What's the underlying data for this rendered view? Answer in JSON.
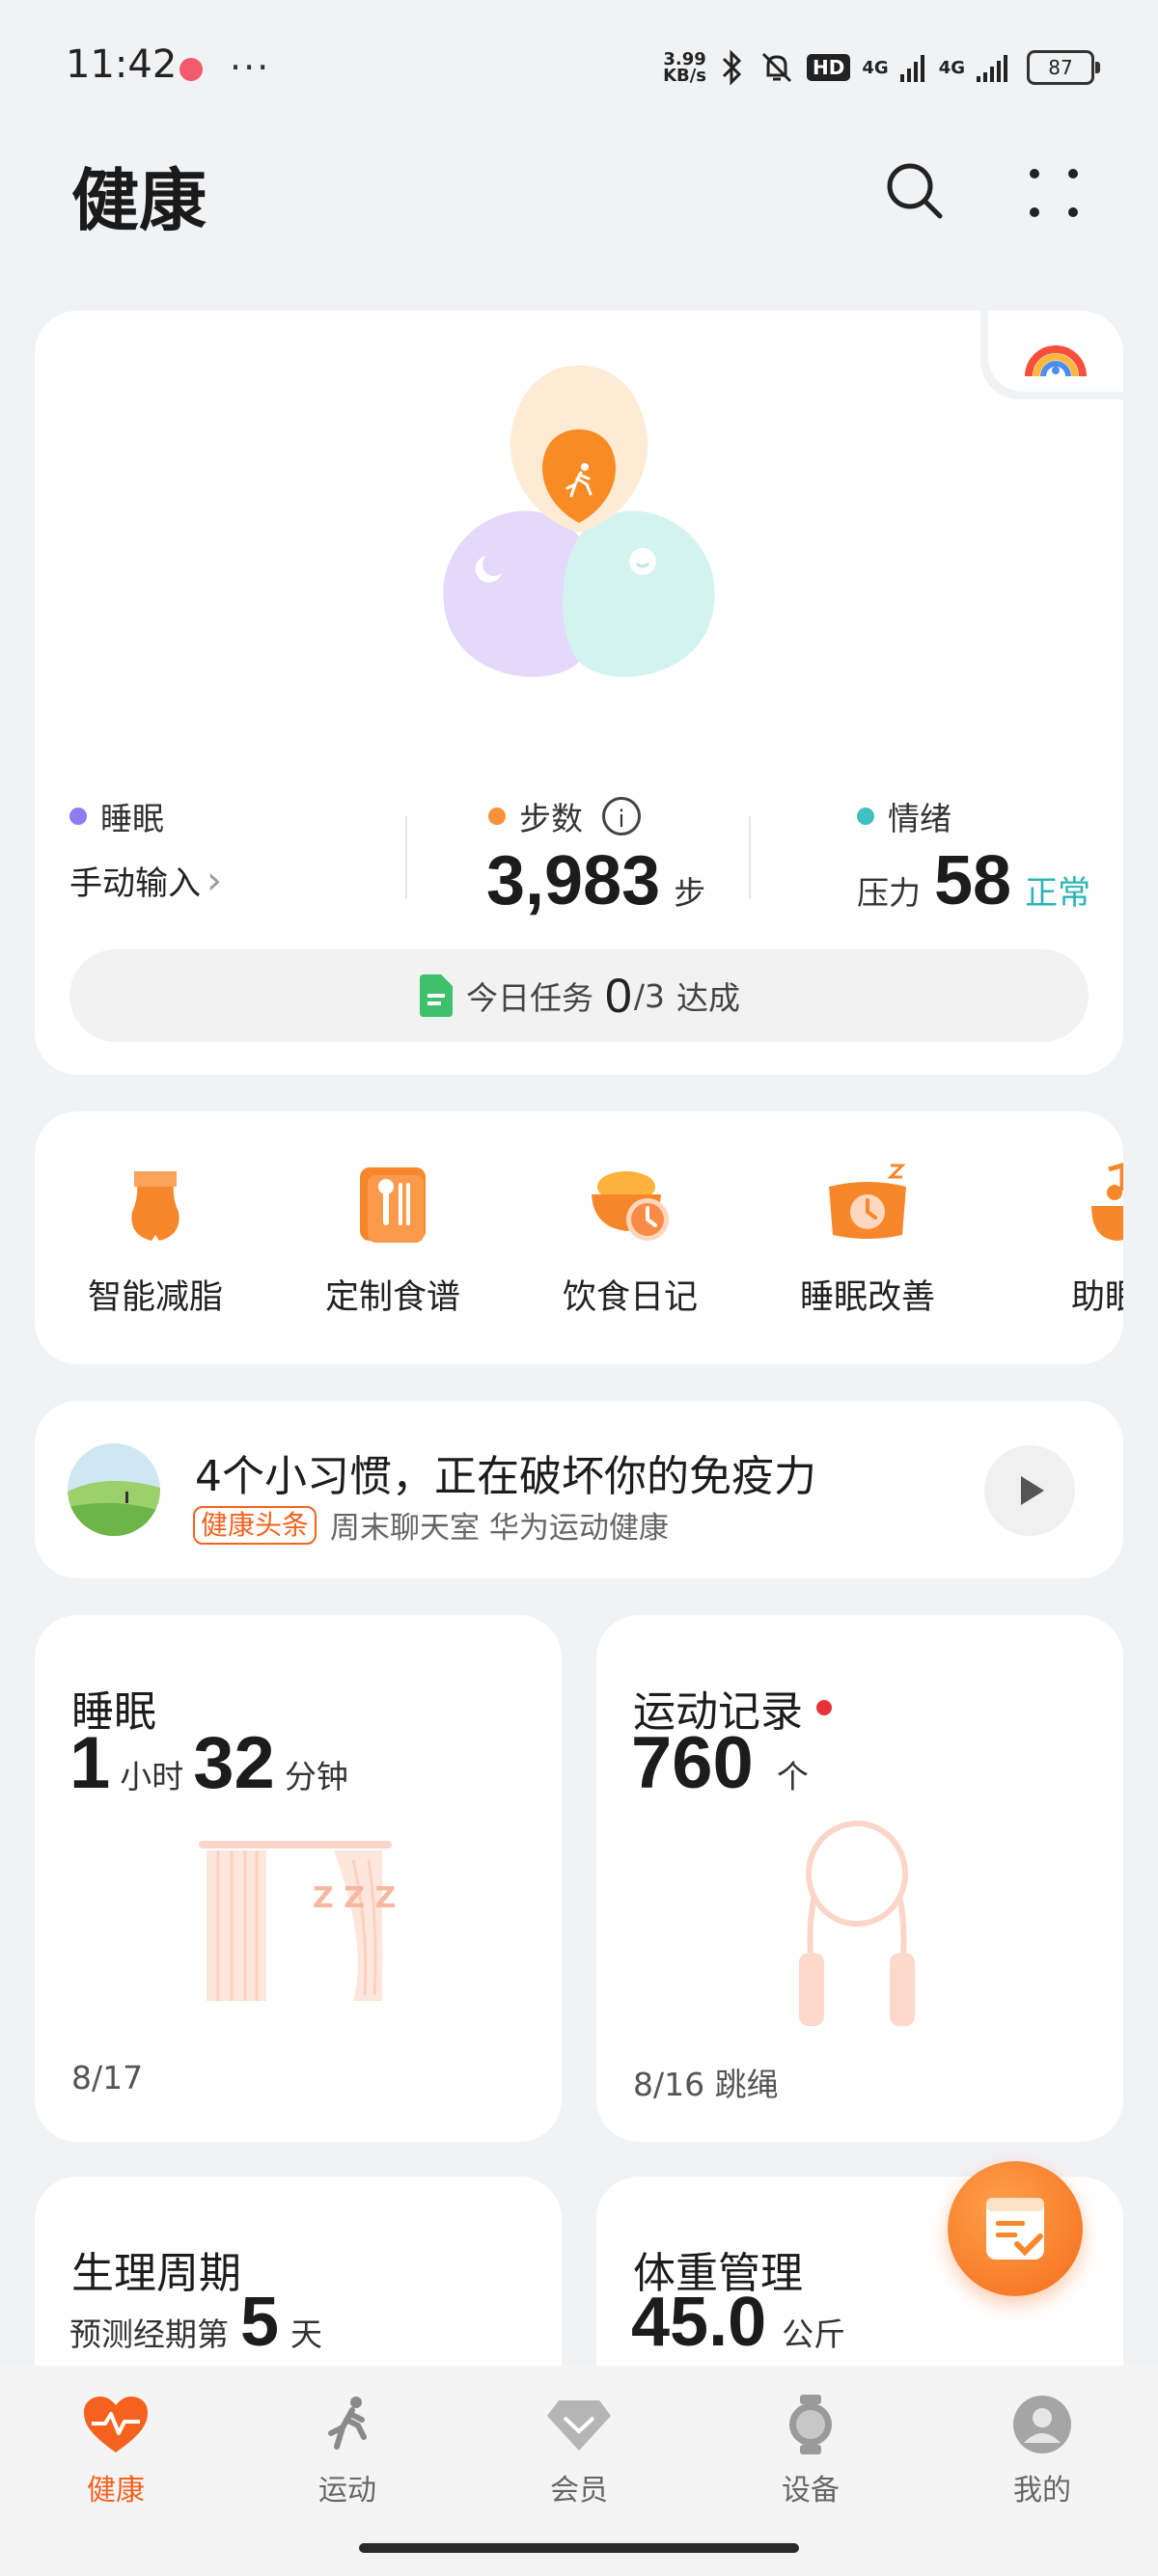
{
  "status_bar": {
    "time": "11:42",
    "more": "···",
    "net_speed_top": "3.99",
    "net_speed_bottom": "KB/s",
    "hd": "HD",
    "sig1": "4G",
    "sig2": "4G",
    "battery": "87"
  },
  "header": {
    "title": "健康"
  },
  "summary": {
    "sleep": {
      "label": "睡眠",
      "value": "手动输入",
      "chevron": "›"
    },
    "steps": {
      "label": "步数",
      "value": "3,983",
      "unit": "步",
      "info": "i"
    },
    "mood": {
      "label": "情绪",
      "prefix": "压力",
      "value": "58",
      "status": "正常"
    },
    "task": {
      "prefix": "今日任务",
      "done": "0",
      "total": "/3",
      "suffix": "达成"
    }
  },
  "features": [
    {
      "label": "智能减脂",
      "icon": "body-shape-icon"
    },
    {
      "label": "定制食谱",
      "icon": "recipe-icon"
    },
    {
      "label": "饮食日记",
      "icon": "food-bowl-icon"
    },
    {
      "label": "睡眠改善",
      "icon": "sleep-pillow-icon"
    },
    {
      "label": "助眠",
      "icon": "music-note-icon"
    }
  ],
  "article": {
    "title": "4个小习惯，正在破坏你的免疫力",
    "tag": "健康头条",
    "source": "周末聊天室 华为运动健康"
  },
  "cards": {
    "sleep": {
      "title": "睡眠",
      "h": "1",
      "h_unit": "小时",
      "m": "32",
      "m_unit": "分钟",
      "date": "8/17",
      "zzz": "Z Z Z"
    },
    "exercise": {
      "title": "运动记录",
      "value": "760",
      "unit": "个",
      "date": "8/16 跳绳"
    },
    "period": {
      "title": "生理周期",
      "prefix": "预测经期第",
      "value": "5",
      "unit": "天"
    },
    "weight": {
      "title": "体重管理",
      "value": "45.0",
      "unit": "公斤"
    }
  },
  "nav": [
    {
      "label": "健康",
      "icon": "heart-pulse-icon",
      "active": true
    },
    {
      "label": "运动",
      "icon": "runner-icon",
      "active": false
    },
    {
      "label": "会员",
      "icon": "diamond-icon",
      "active": false
    },
    {
      "label": "设备",
      "icon": "watch-icon",
      "active": false
    },
    {
      "label": "我的",
      "icon": "profile-icon",
      "active": false
    }
  ],
  "colors": {
    "accent": "#f5621e",
    "sleep_dot": "#8e7cf0",
    "steps_dot": "#f7913a",
    "mood_dot": "#3fc1c3",
    "normal_text": "#2cb5b5"
  }
}
